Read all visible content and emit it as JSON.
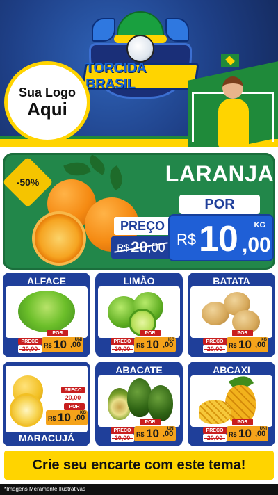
{
  "header": {
    "logo_line1": "Sua Logo",
    "logo_line2": "Aqui",
    "badge_text": "TORCIDA BRASIL"
  },
  "featured": {
    "discount": "-50%",
    "name": "LARANJA",
    "por_label": "POR",
    "preco_label": "PREÇO",
    "old_currency": "R$",
    "old_int": "20",
    "old_dec": ",00",
    "new_currency": "R$",
    "new_int": "10",
    "new_dec": ",00",
    "unit": "KG"
  },
  "products": [
    {
      "name": "ALFACE",
      "preco_label": "PRECO",
      "old_price": "20,00",
      "por_label": "POR",
      "currency": "R$",
      "int": "10",
      "dec": ",00",
      "unit": "UNI"
    },
    {
      "name": "LIMÃO",
      "preco_label": "PRECO",
      "old_price": "20,00",
      "por_label": "POR",
      "currency": "R$",
      "int": "10",
      "dec": ",00",
      "unit": "KG"
    },
    {
      "name": "BATATA",
      "preco_label": "PRECO",
      "old_price": "20,00",
      "por_label": "POR",
      "currency": "R$",
      "int": "10",
      "dec": ",00",
      "unit": "KG"
    },
    {
      "name": "MARACUJÁ",
      "preco_label": "PRECO",
      "old_price": "20,00",
      "por_label": "POR",
      "currency": "R$",
      "int": "10",
      "dec": ",00",
      "unit": "KG"
    },
    {
      "name": "ABACATE",
      "preco_label": "PRECO",
      "old_price": "20,00",
      "por_label": "POR",
      "currency": "R$",
      "int": "10",
      "dec": ",00",
      "unit": "UNI"
    },
    {
      "name": "ABCAXI",
      "preco_label": "PRECO",
      "old_price": "20,00",
      "por_label": "POR",
      "currency": "R$",
      "int": "10",
      "dec": ",00",
      "unit": "UNI"
    }
  ],
  "cta": "Crie seu encarte com este tema!",
  "disclaimer": "*Imagens Meramente Ilustrativas",
  "colors": {
    "blue": "#1f3f9a",
    "green": "#22874a",
    "yellow": "#ffd400",
    "orange_tag": "#f5a31a",
    "red_tag": "#c81e1e"
  }
}
